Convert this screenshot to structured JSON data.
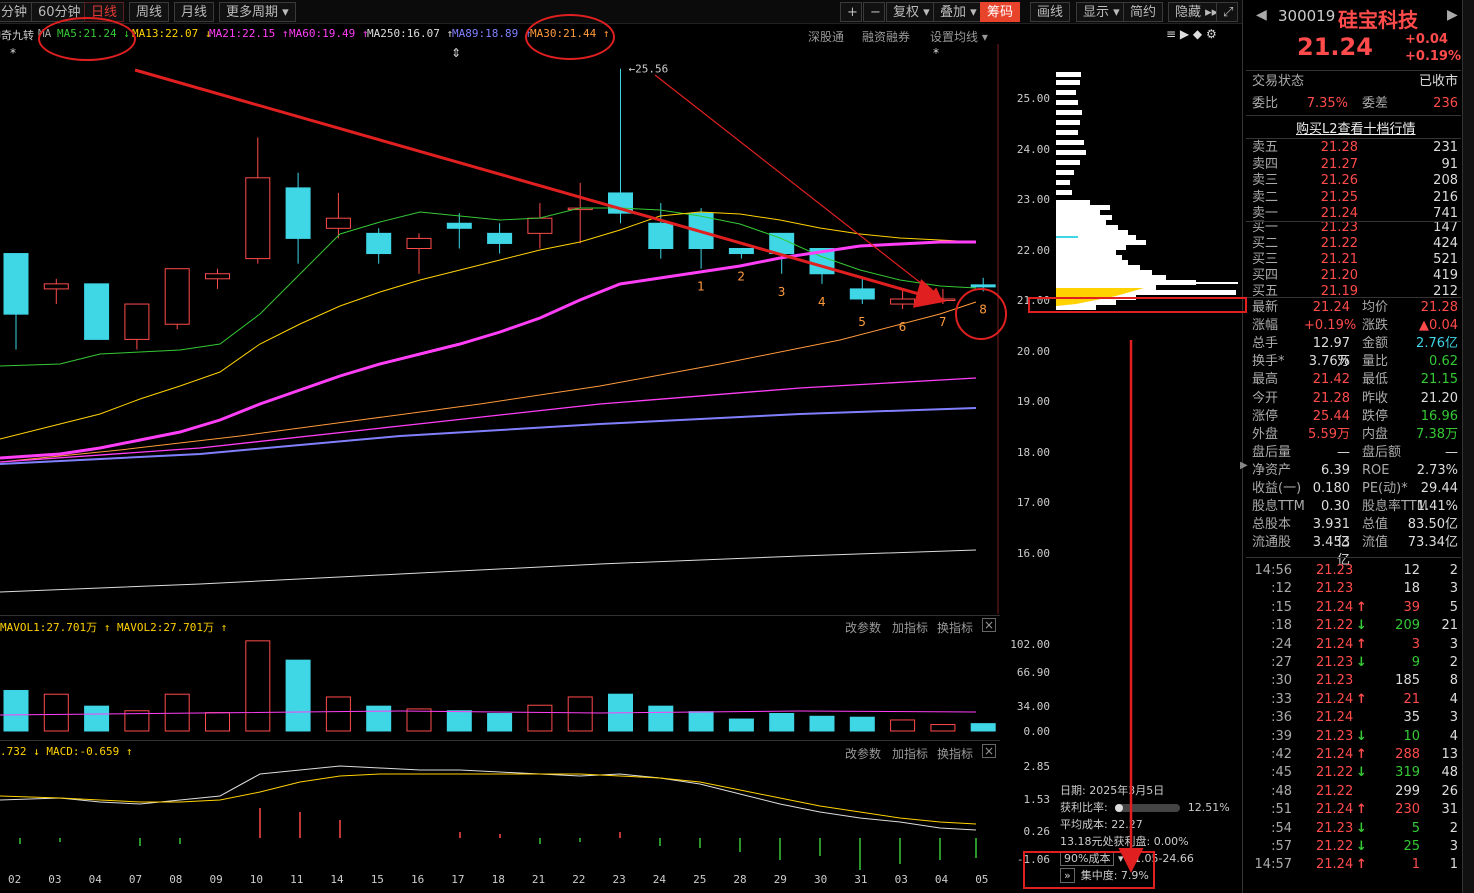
{
  "toolbar": {
    "period_tabs": [
      "分钟",
      "60分钟",
      "日线",
      "周线",
      "月线",
      "更多周期"
    ],
    "right_buttons": [
      "+",
      "−",
      "复权",
      "叠加",
      "筹码",
      "画线",
      "显示",
      "简约",
      "隐藏"
    ],
    "active_tab": "日线",
    "active_button": "筹码"
  },
  "indicator_name": "神奇九转",
  "ma_legend": [
    {
      "label": "MA5:21.24",
      "color": "#35c935",
      "arrow": "↓"
    },
    {
      "label": "MA13:22.07",
      "color": "#ffd200",
      "arrow": "↓"
    },
    {
      "label": "MA21:22.15",
      "color": "#ff3ef7",
      "arrow": "↑"
    },
    {
      "label": "MA60:19.49",
      "color": "#ff3ef7",
      "arrow": "↑"
    },
    {
      "label": "MA250:16.07",
      "color": "#dddddd",
      "arrow": "↑"
    },
    {
      "label": "MA89:18.89",
      "color": "#8080ff",
      "arrow": "↑"
    },
    {
      "label": "MA30:21.44",
      "color": "#ff9a3c",
      "arrow": "↑"
    }
  ],
  "chart_links": {
    "shengu": "深股通",
    "rongzi": "融资融券",
    "ma_settings": "设置均线"
  },
  "price_axis": [
    "25.00",
    "24.00",
    "23.00",
    "22.00",
    "21.00",
    "20.00",
    "19.00",
    "18.00",
    "17.00",
    "16.00"
  ],
  "high_marker": "25.56",
  "nine_turn_labels": [
    "1",
    "2",
    "3",
    "4",
    "5",
    "6",
    "7",
    "8"
  ],
  "x_axis": [
    "02",
    "03",
    "04",
    "07",
    "08",
    "09",
    "10",
    "11",
    "14",
    "15",
    "16",
    "17",
    "18",
    "21",
    "22",
    "23",
    "24",
    "25",
    "28",
    "29",
    "30",
    "31",
    "03",
    "04",
    "05"
  ],
  "volume": {
    "legend": "MAVOL1:27.701万 ↑  MAVOL2:27.701万 ↑",
    "axis": [
      "102.00",
      "66.90",
      "34.00",
      "0.00"
    ],
    "links": [
      "改参数",
      "加指标",
      "换指标"
    ]
  },
  "macd": {
    "legend": ".732 ↓  MACD:-0.659 ↑",
    "axis": [
      "2.85",
      "1.53",
      "0.26",
      "-1.06"
    ],
    "links": [
      "改参数",
      "加指标",
      "换指标"
    ]
  },
  "chip": {
    "date": "日期: 2025年3月5日",
    "profit_label": "获利比率:",
    "profit_value": "12.51%",
    "avg_cost": "平均成本: 22.27",
    "profit_at": "13.18元处获利盘: 0.00%",
    "cost_mode": "90%成本",
    "cost_range": "21.05-24.66",
    "concentration": "集中度: 7.9%"
  },
  "stock": {
    "code": "300019",
    "name": "硅宝科技",
    "price": "21.24",
    "change": "+0.04",
    "change_pct": "+0.19%",
    "trade_status_label": "交易状态",
    "trade_status": "已收市",
    "weibi_label": "委比",
    "weibi": "7.35%",
    "weicha_label": "委差",
    "weicha": "236",
    "l2_link": "购买L2查看十档行情"
  },
  "asks": [
    {
      "label": "卖五",
      "price": "21.28",
      "vol": "231"
    },
    {
      "label": "卖四",
      "price": "21.27",
      "vol": "91"
    },
    {
      "label": "卖三",
      "price": "21.26",
      "vol": "208"
    },
    {
      "label": "卖二",
      "price": "21.25",
      "vol": "216"
    },
    {
      "label": "卖一",
      "price": "21.24",
      "vol": "741"
    }
  ],
  "bids": [
    {
      "label": "买一",
      "price": "21.23",
      "vol": "147"
    },
    {
      "label": "买二",
      "price": "21.22",
      "vol": "424"
    },
    {
      "label": "买三",
      "price": "21.21",
      "vol": "521"
    },
    {
      "label": "买四",
      "price": "21.20",
      "vol": "419"
    },
    {
      "label": "买五",
      "price": "21.19",
      "vol": "212"
    }
  ],
  "stats": [
    [
      "最新",
      "21.24",
      "均价",
      "21.28"
    ],
    [
      "涨幅",
      "+0.19%",
      "涨跌",
      "▲0.04"
    ],
    [
      "总手",
      "12.97万",
      "金额",
      "2.76亿"
    ],
    [
      "换手*",
      "3.76%",
      "量比",
      "0.62"
    ],
    [
      "最高",
      "21.42",
      "最低",
      "21.15"
    ],
    [
      "今开",
      "21.28",
      "昨收",
      "21.20"
    ],
    [
      "涨停",
      "25.44",
      "跌停",
      "16.96"
    ],
    [
      "外盘",
      "5.59万",
      "内盘",
      "7.38万"
    ],
    [
      "盘后量",
      "—",
      "盘后额",
      "—"
    ],
    [
      "净资产",
      "6.39",
      "ROE",
      "2.73%"
    ],
    [
      "收益(一)",
      "0.180",
      "PE(动)*",
      "29.44"
    ],
    [
      "股息TTM",
      "0.30",
      "股息率TTM",
      "1.41%"
    ],
    [
      "总股本",
      "3.931亿",
      "总值",
      "83.50亿"
    ],
    [
      "流通股",
      "3.453亿",
      "流值",
      "73.34亿"
    ]
  ],
  "ticks": [
    {
      "time": "14:56",
      "price": "21.23",
      "dir": "",
      "vol": "12",
      "n": "2"
    },
    {
      "time": ":12",
      "price": "21.23",
      "dir": "",
      "vol": "18",
      "n": "3"
    },
    {
      "time": ":15",
      "price": "21.24",
      "dir": "↑",
      "vol": "39",
      "n": "5"
    },
    {
      "time": ":18",
      "price": "21.22",
      "dir": "↓",
      "vol": "209",
      "n": "21"
    },
    {
      "time": ":24",
      "price": "21.24",
      "dir": "↑",
      "vol": "3",
      "n": "3"
    },
    {
      "time": ":27",
      "price": "21.23",
      "dir": "↓",
      "vol": "9",
      "n": "2"
    },
    {
      "time": ":30",
      "price": "21.23",
      "dir": "",
      "vol": "185",
      "n": "8"
    },
    {
      "time": ":33",
      "price": "21.24",
      "dir": "↑",
      "vol": "21",
      "n": "4"
    },
    {
      "time": ":36",
      "price": "21.24",
      "dir": "",
      "vol": "35",
      "n": "3"
    },
    {
      "time": ":39",
      "price": "21.23",
      "dir": "↓",
      "vol": "10",
      "n": "4"
    },
    {
      "time": ":42",
      "price": "21.24",
      "dir": "↑",
      "vol": "288",
      "n": "13"
    },
    {
      "time": ":45",
      "price": "21.22",
      "dir": "↓",
      "vol": "319",
      "n": "48"
    },
    {
      "time": ":48",
      "price": "21.22",
      "dir": "",
      "vol": "299",
      "n": "26"
    },
    {
      "time": ":51",
      "price": "21.24",
      "dir": "↑",
      "vol": "230",
      "n": "31"
    },
    {
      "time": ":54",
      "price": "21.23",
      "dir": "↓",
      "vol": "5",
      "n": "2"
    },
    {
      "time": ":57",
      "price": "21.22",
      "dir": "↓",
      "vol": "25",
      "n": "3"
    },
    {
      "time": "14:57",
      "price": "21.24",
      "dir": "↑",
      "vol": "1",
      "n": "1"
    }
  ],
  "chart_data": {
    "type": "candlestick",
    "categories": [
      "02",
      "03",
      "04",
      "07",
      "08",
      "09",
      "10",
      "11",
      "14",
      "15",
      "16",
      "17",
      "18",
      "21",
      "22",
      "23",
      "24",
      "25",
      "28",
      "29",
      "30",
      "31",
      "03",
      "04",
      "05"
    ],
    "ohlc": [
      [
        21.9,
        20.7,
        21.8,
        20.0
      ],
      [
        21.2,
        21.3,
        20.9,
        21.4
      ],
      [
        21.3,
        20.2,
        21.3,
        20.2
      ],
      [
        20.2,
        20.9,
        20.0,
        20.9
      ],
      [
        20.5,
        21.6,
        20.4,
        21.6
      ],
      [
        21.4,
        21.5,
        21.2,
        21.6
      ],
      [
        21.8,
        23.4,
        21.7,
        24.2
      ],
      [
        23.2,
        22.2,
        21.7,
        23.5
      ],
      [
        22.4,
        22.6,
        22.2,
        23.1
      ],
      [
        22.3,
        21.9,
        21.7,
        22.4
      ],
      [
        22.0,
        22.2,
        21.5,
        22.3
      ],
      [
        22.5,
        22.4,
        22.0,
        22.7
      ],
      [
        22.3,
        22.1,
        21.9,
        22.5
      ],
      [
        22.3,
        22.6,
        22.0,
        22.9
      ],
      [
        22.8,
        22.8,
        22.1,
        23.3
      ],
      [
        23.1,
        22.7,
        22.5,
        25.56
      ],
      [
        22.5,
        22.0,
        21.8,
        22.9
      ],
      [
        22.7,
        22.0,
        21.6,
        22.8
      ],
      [
        22.0,
        21.9,
        21.8,
        22.0
      ],
      [
        22.3,
        21.9,
        21.5,
        22.0
      ],
      [
        22.0,
        21.5,
        21.3,
        22.0
      ],
      [
        21.2,
        21.0,
        20.9,
        21.4
      ],
      [
        20.9,
        21.0,
        20.8,
        21.2
      ],
      [
        21.0,
        21.0,
        20.9,
        21.2
      ],
      [
        21.28,
        21.24,
        21.15,
        21.42
      ]
    ],
    "volume": [
      44,
      40,
      27,
      22,
      40,
      20,
      98,
      77,
      37,
      27,
      24,
      22,
      19,
      28,
      37,
      40,
      27,
      21,
      13,
      19,
      16,
      15,
      12,
      7,
      8
    ],
    "ylim": [
      15.5,
      25.8
    ]
  }
}
